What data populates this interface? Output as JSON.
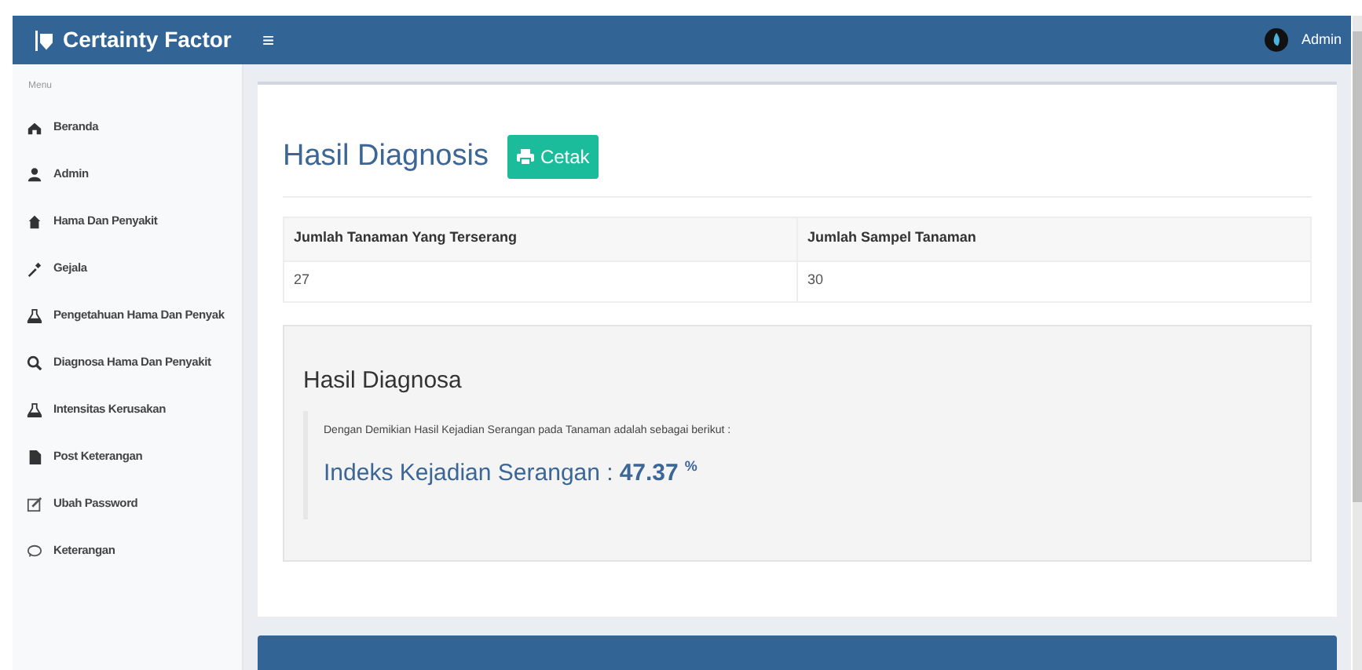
{
  "header": {
    "brand": "Certainty Factor",
    "menu_toggle": "≡",
    "user": "Admin"
  },
  "sidebar": {
    "heading": "Menu",
    "items": [
      {
        "label": "Beranda"
      },
      {
        "label": "Admin"
      },
      {
        "label": "Hama Dan Penyakit"
      },
      {
        "label": "Gejala"
      },
      {
        "label": "Pengetahuan Hama Dan Penyak"
      },
      {
        "label": "Diagnosa Hama Dan Penyakit"
      },
      {
        "label": "Intensitas Kerusakan"
      },
      {
        "label": "Post Keterangan"
      },
      {
        "label": "Ubah Password"
      },
      {
        "label": "Keterangan"
      }
    ]
  },
  "page": {
    "title": "Hasil Diagnosis",
    "print_button": "Cetak",
    "table": {
      "columns": [
        "Jumlah Tanaman Yang Terserang",
        "Jumlah Sampel Tanaman"
      ],
      "rows": [
        [
          "27",
          "30"
        ]
      ]
    },
    "result": {
      "title": "Hasil Diagnosa",
      "sentence": "Dengan Demikian Hasil Kejadian Serangan pada Tanaman adalah sebagai berikut :",
      "index_label": "Indeks Kejadian Serangan :",
      "index_value": "47.37",
      "unit": "%"
    }
  }
}
